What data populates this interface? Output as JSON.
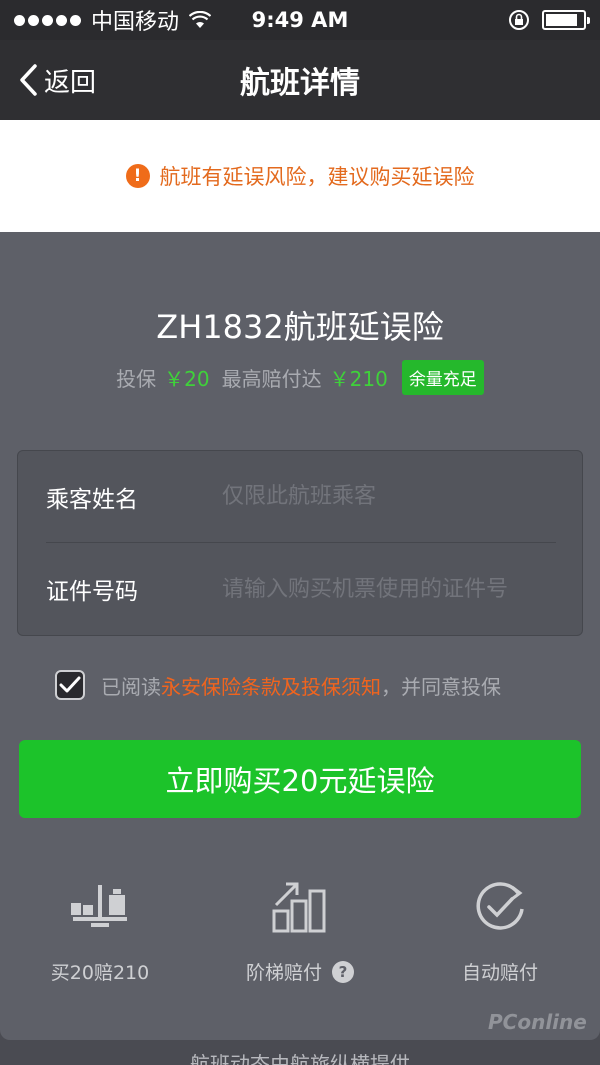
{
  "status_bar": {
    "carrier": "中国移动",
    "time": "9:49 AM",
    "battery_level": 0.85
  },
  "nav": {
    "back_label": "返回",
    "title": "航班详情"
  },
  "warning": {
    "text": "航班有延误风险，建议购买延误险",
    "icon_glyph": "!"
  },
  "insurance": {
    "title": "ZH1832航班延误险",
    "premium_label": "投保",
    "premium_value": "￥20",
    "max_payout_label": "最高赔付达",
    "max_payout_value": "￥210",
    "stock_badge": "余量充足"
  },
  "form": {
    "name_label": "乘客姓名",
    "name_placeholder": "仅限此航班乘客",
    "id_label": "证件号码",
    "id_placeholder": "请输入购买机票使用的证件号"
  },
  "agreement": {
    "checked": true,
    "prefix": "已阅读",
    "link": "永安保险条款及投保须知",
    "suffix": "，并同意投保"
  },
  "buy_button": "立即购买20元延误险",
  "features": [
    {
      "label": "买20赔210",
      "icon": "scale-icon"
    },
    {
      "label": "阶梯赔付",
      "icon": "stairs-chart-icon"
    },
    {
      "label": "自动赔付",
      "icon": "auto-check-icon"
    }
  ],
  "help_glyph": "?",
  "watermark": "PConline",
  "bottom_text": "航班动态由航旅纵横提供",
  "colors": {
    "warning_orange": "#e36a1e",
    "green": "#1cc32a",
    "panel_bg": "#5e6068",
    "nav_bg": "#2f2f32"
  }
}
